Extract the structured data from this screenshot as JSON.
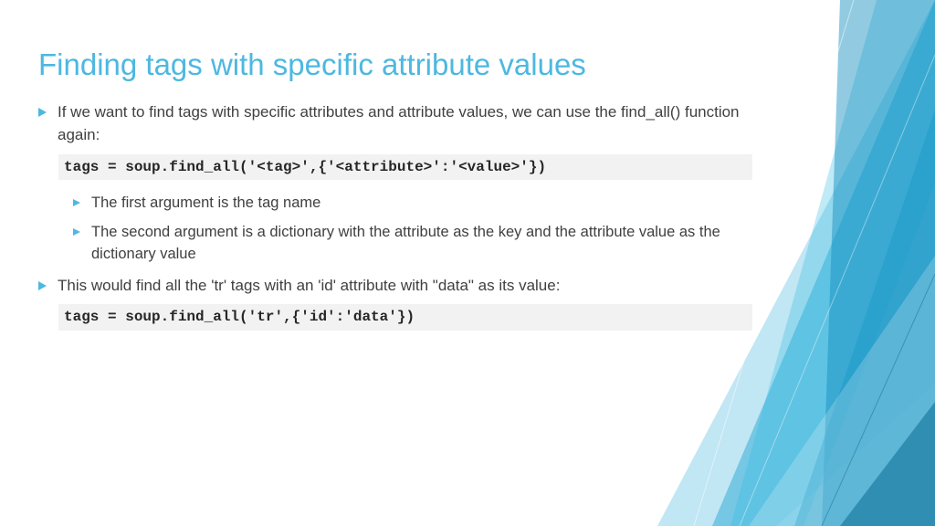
{
  "title": "Finding tags with specific attribute values",
  "bullets": {
    "b1": "If we want to find tags with specific attributes and attribute values, we can use the find_all() function again:",
    "code1": "tags = soup.find_all('<tag>',{'<attribute>':'<value>'})",
    "b1a": "The first argument is the tag name",
    "b1b": "The second argument is a dictionary with the attribute as the key and the attribute value as the dictionary value",
    "b2": "This would find all the 'tr' tags with an 'id' attribute with \"data\" as its value:",
    "code2": "tags = soup.find_all('tr',{'id':'data'})"
  }
}
